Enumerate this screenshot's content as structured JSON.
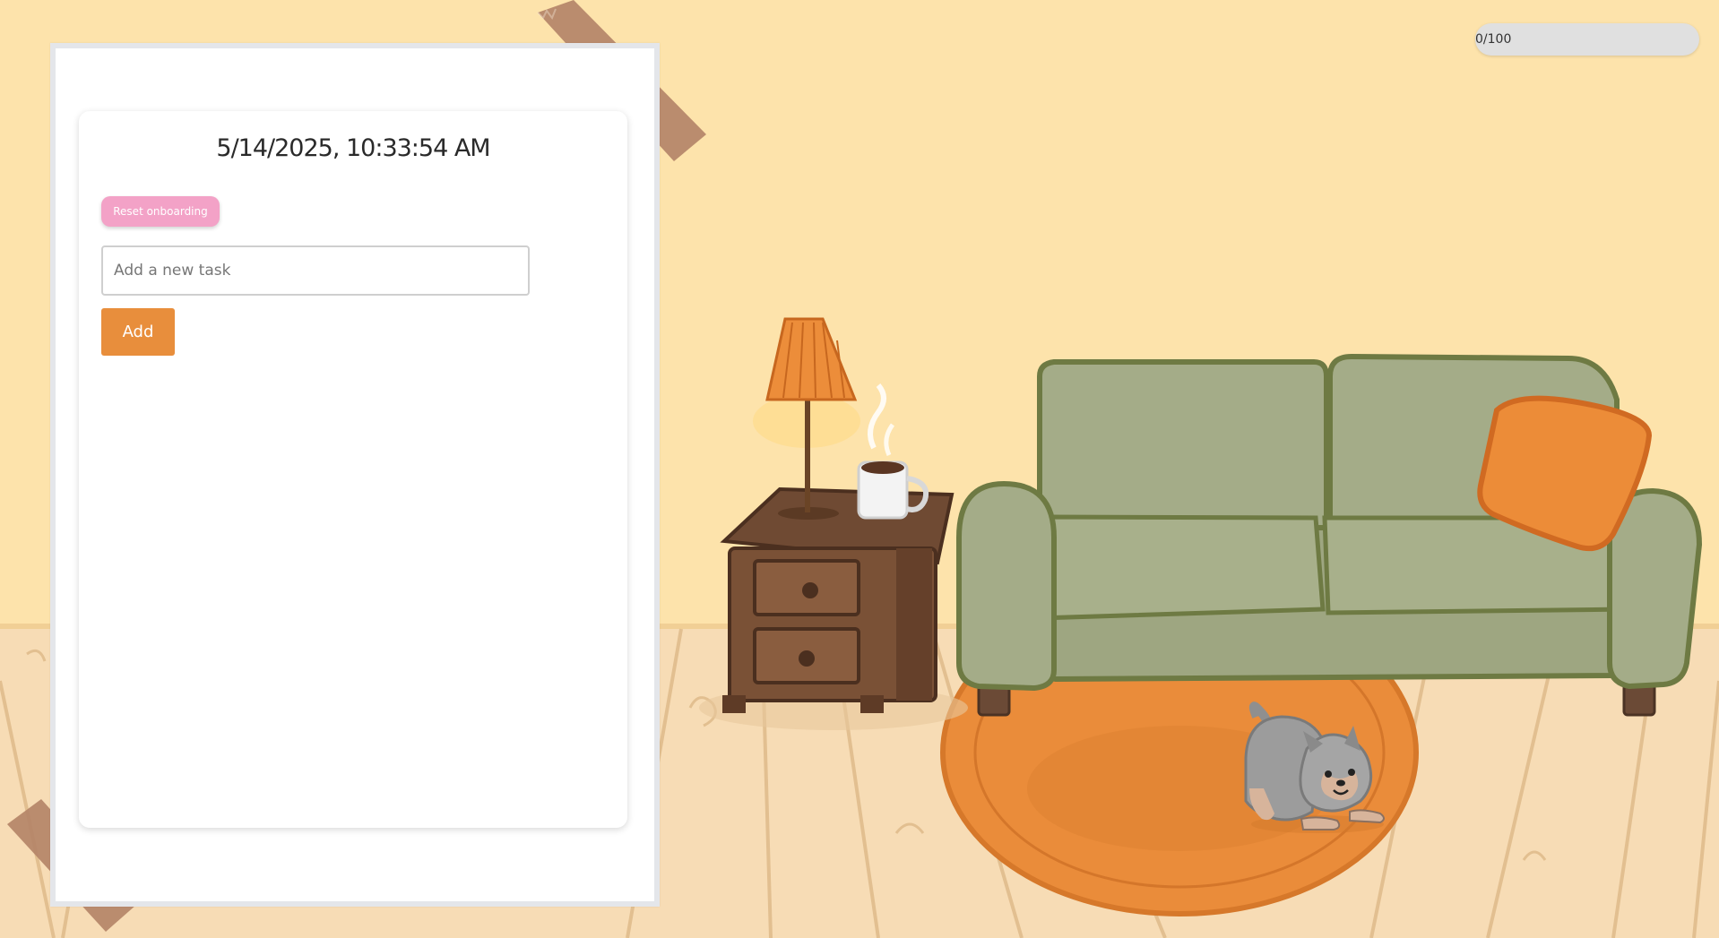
{
  "app": {
    "datetime": "5/14/2025, 10:33:54 AM",
    "reset_label": "Reset onboarding",
    "add_label": "Add",
    "task_input": {
      "placeholder": "Add a new task",
      "value": ""
    },
    "tasks": []
  },
  "progress": {
    "text": "0/100",
    "current": 0,
    "max": 100
  },
  "colors": {
    "wall": "#fde3ab",
    "floor": "#f6dbb6",
    "accent_orange": "#e88e3c",
    "reset_pink": "#f3a2c7",
    "sofa_green": "#a3ab87",
    "rug_orange": "#ea8c3a"
  }
}
